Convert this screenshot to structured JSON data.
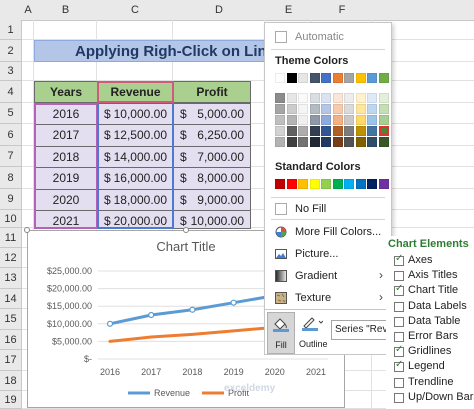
{
  "sheet": {
    "columns": [
      "A",
      "B",
      "C",
      "D",
      "E",
      "F"
    ],
    "rows": [
      "1",
      "2",
      "3",
      "4",
      "5",
      "6",
      "7",
      "8",
      "9",
      "10",
      "11",
      "12",
      "13",
      "14",
      "15",
      "16",
      "17",
      "18",
      "19"
    ]
  },
  "title_cell": "Applying Righ-Click on Lin",
  "table": {
    "headers": [
      "Years",
      "Revenue",
      "Profit"
    ],
    "rows": [
      {
        "year": "2016",
        "rev_cur": "$",
        "rev": "10,000.00",
        "pro_cur": "$",
        "pro": "5,000.00"
      },
      {
        "year": "2017",
        "rev_cur": "$",
        "rev": "12,500.00",
        "pro_cur": "$",
        "pro": "6,250.00"
      },
      {
        "year": "2018",
        "rev_cur": "$",
        "rev": "14,000.00",
        "pro_cur": "$",
        "pro": "7,000.00"
      },
      {
        "year": "2019",
        "rev_cur": "$",
        "rev": "16,000.00",
        "pro_cur": "$",
        "pro": "8,000.00"
      },
      {
        "year": "2020",
        "rev_cur": "$",
        "rev": "18,000.00",
        "pro_cur": "$",
        "pro": "9,000.00"
      },
      {
        "year": "2021",
        "rev_cur": "$",
        "rev": "20,000.00",
        "pro_cur": "$",
        "pro": "10,000.00"
      }
    ]
  },
  "chart_data": {
    "type": "line",
    "title": "Chart Title",
    "categories": [
      "2016",
      "2017",
      "2018",
      "2019",
      "2020",
      "2021"
    ],
    "y_ticks": [
      "$25,000.00",
      "$20,000.00",
      "$15,000.00",
      "$10,000.00",
      "$5,000.00",
      "$-"
    ],
    "ylim": [
      0,
      25000
    ],
    "series": [
      {
        "name": "Revenue",
        "values": [
          10000,
          12500,
          14000,
          16000,
          18000,
          20000
        ],
        "color": "#5b9bd5"
      },
      {
        "name": "Profit",
        "values": [
          5000,
          6250,
          7000,
          8000,
          9000,
          10000
        ],
        "color": "#ed7d31"
      }
    ],
    "legend": [
      "Revenue",
      "Profit"
    ],
    "legend_position": "bottom",
    "grid": true
  },
  "color_menu": {
    "automatic": "Automatic",
    "theme_colors": "Theme Colors",
    "standard_colors": "Standard Colors",
    "no_fill": "No Fill",
    "more_fill_colors": "More Fill Colors...",
    "picture": "Picture...",
    "gradient": "Gradient",
    "texture": "Texture",
    "theme_row": [
      "#ffffff",
      "#000000",
      "#e7e6e6",
      "#44546a",
      "#4472c4",
      "#ed7d31",
      "#a5a5a5",
      "#ffc000",
      "#5b9bd5",
      "#70ad47"
    ],
    "standard_row": [
      "#c00000",
      "#ff0000",
      "#ffc000",
      "#ffff00",
      "#92d050",
      "#00b050",
      "#00b0f0",
      "#0070c0",
      "#002060",
      "#7030a0"
    ]
  },
  "format_bar": {
    "fill": "Fill",
    "outline": "Outline",
    "series_select": "Series \"Revenue"
  },
  "chart_elements": {
    "title": "Chart Elements",
    "items": [
      {
        "label": "Axes",
        "checked": true
      },
      {
        "label": "Axis Titles",
        "checked": false
      },
      {
        "label": "Chart Title",
        "checked": true
      },
      {
        "label": "Data Labels",
        "checked": false
      },
      {
        "label": "Data Table",
        "checked": false
      },
      {
        "label": "Error Bars",
        "checked": false
      },
      {
        "label": "Gridlines",
        "checked": true
      },
      {
        "label": "Legend",
        "checked": true
      },
      {
        "label": "Trendline",
        "checked": false
      },
      {
        "label": "Up/Down Bars",
        "checked": false
      }
    ]
  },
  "watermark": "exceldemy"
}
